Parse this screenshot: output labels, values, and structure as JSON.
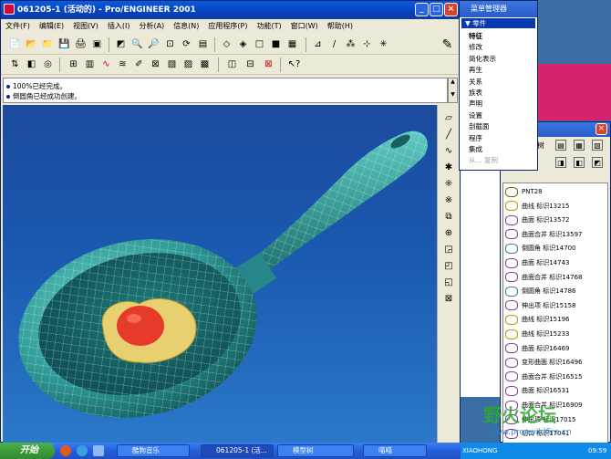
{
  "main_window": {
    "title": "061205-1 (活动的) - Pro/ENGINEER 2001",
    "minimize": "_",
    "maximize": "□",
    "close": "×"
  },
  "menubar": [
    "文件(F)",
    "编辑(E)",
    "视图(V)",
    "插入(I)",
    "分析(A)",
    "信息(N)",
    "应用程序(P)",
    "功能(T)",
    "窗口(W)",
    "帮助(H)"
  ],
  "messages": [
    "100%已经完成。",
    "倒圆角已经成功创建。"
  ],
  "menu_manager": {
    "title": "菜单管理器",
    "header": "▼ 零件",
    "items": [
      "特征",
      "修改",
      "简化表示",
      "再生",
      "关系",
      "族表",
      "声明",
      "设置",
      "剖截面",
      "程序",
      "集成",
      "从... 复制"
    ]
  },
  "feature_window": {
    "label": "树",
    "items": [
      {
        "label": "PNT28",
        "icon": "point-icon",
        "color": "#6b6b00"
      },
      {
        "label": "曲线 标识13215",
        "icon": "curve-icon",
        "color": "#c89000"
      },
      {
        "label": "曲面 标识13572",
        "icon": "surface-icon",
        "color": "#8a3a9a"
      },
      {
        "label": "曲面合并 标识13597",
        "icon": "merge-icon",
        "color": "#8a3a9a"
      },
      {
        "label": "倒圆角 标识14700",
        "icon": "round-icon",
        "color": "#2a8a7a"
      },
      {
        "label": "曲面 标识14743",
        "icon": "surface-icon",
        "color": "#8a3a9a"
      },
      {
        "label": "曲面合并 标识14768",
        "icon": "merge-icon",
        "color": "#8a3a9a"
      },
      {
        "label": "倒圆角 标识14786",
        "icon": "round-icon",
        "color": "#2a8a7a"
      },
      {
        "label": "伸出项 标识15158",
        "icon": "protrusion-icon",
        "color": "#8a3a9a"
      },
      {
        "label": "曲线 标识15196",
        "icon": "curve-icon",
        "color": "#c89000"
      },
      {
        "label": "曲线 标识15233",
        "icon": "curve-icon",
        "color": "#c89000"
      },
      {
        "label": "曲面 标识16469",
        "icon": "surface-icon",
        "color": "#8a3a9a"
      },
      {
        "label": "变形曲面 标识16496",
        "icon": "warp-icon",
        "color": "#8a3a9a"
      },
      {
        "label": "曲面合并 标识16515",
        "icon": "merge-icon",
        "color": "#8a3a9a"
      },
      {
        "label": "曲面 标识16531",
        "icon": "surface-icon",
        "color": "#8a3a9a"
      },
      {
        "label": "曲面合并 标识16909",
        "icon": "merge-icon",
        "color": "#8a3a9a"
      },
      {
        "label": "伸出项 标识17015",
        "icon": "protrusion-icon",
        "color": "#8a3a9a"
      },
      {
        "label": "切口 标识17041",
        "icon": "cut-icon",
        "color": "#8a3a9a"
      }
    ]
  },
  "watermark": "野火论坛",
  "watermark_url": "www.proewildfire.cn",
  "taskbar": {
    "start": "开始",
    "items": [
      "酷狗音乐",
      "061205-1 (活...",
      "模型树",
      "喵喵"
    ],
    "tray_text": "XIAOHONG",
    "clock": "09:59"
  },
  "colors": {
    "titlebar": "#0a5ae0",
    "viewport_top": "#1c4a9e",
    "model": "#2f9c98",
    "yolk": "#e63a2a",
    "egg_white": "#e8d070"
  }
}
